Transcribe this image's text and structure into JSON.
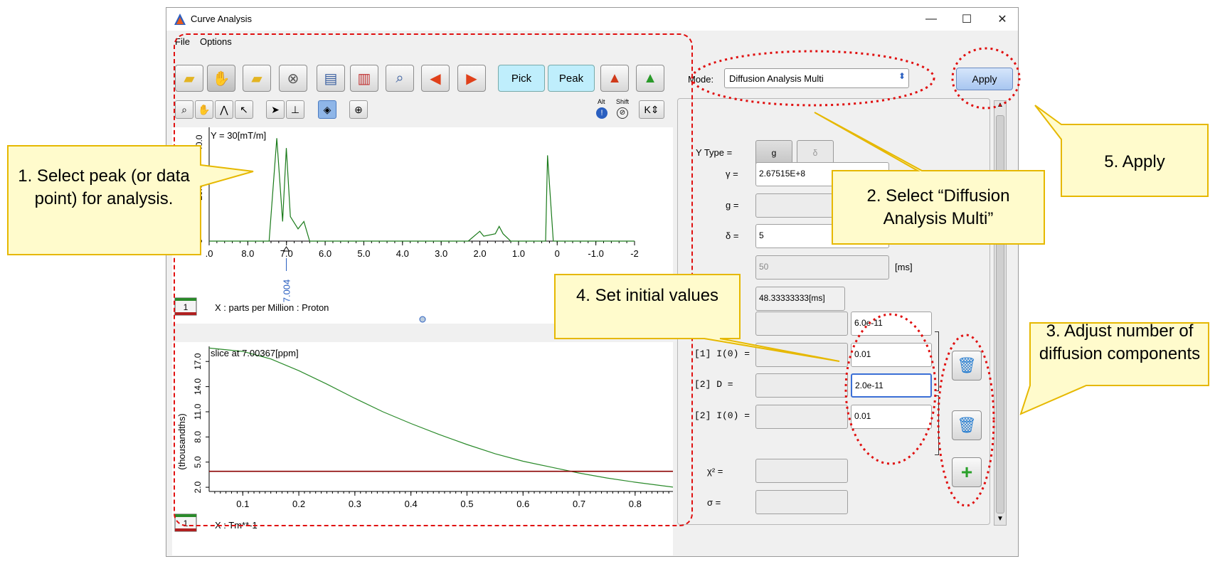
{
  "window": {
    "title": "Curve Analysis",
    "minimize": "—",
    "maximize": "☐",
    "close": "✕"
  },
  "menu": [
    "File",
    "Options"
  ],
  "toolbar": {
    "pick": "Pick",
    "peak": "Peak"
  },
  "mode": {
    "label": "Mode:",
    "value": "Diffusion Analysis Multi",
    "apply": "Apply"
  },
  "subtoolbar": {
    "alt": "Alt",
    "shift": "Shift"
  },
  "upper_plot": {
    "legend": "Y = 30[mT/m]",
    "peak_marker": "7.004",
    "x_ticks": [
      ".0",
      "8.0",
      "7.0",
      "6.0",
      "5.0",
      "4.0",
      "3.0",
      "2.0",
      "1.0",
      "0",
      "-1.0",
      "-2"
    ],
    "y_ticks": [
      "40.0",
      "20.0",
      "0"
    ],
    "xlabel": "X : parts per Million : Proton",
    "page": "1"
  },
  "lower_plot": {
    "legend": "slice at 7.00367[ppm]",
    "x_ticks": [
      "0.1",
      "0.2",
      "0.3",
      "0.4",
      "0.5",
      "0.6",
      "0.7",
      "0.8"
    ],
    "y_ticks": [
      "17.0",
      "14.0",
      "11.0",
      "8.0",
      "5.0",
      "2.0"
    ],
    "ylabel": "(thousandths)",
    "xlabel": "X : Tm**-1",
    "page": "1"
  },
  "chart_data": [
    {
      "type": "line",
      "title": "Y = 30[mT/m]",
      "xlabel": "X : parts per Million : Proton",
      "xlim": [
        9,
        -2
      ],
      "series": [
        {
          "x": [
            9,
            7.45,
            7.25,
            7.1,
            7.004,
            6.9,
            6.7,
            6.55,
            6.4,
            2.3,
            2.0,
            1.9,
            1.6,
            1.5,
            1.4,
            1.2,
            0.3,
            0.25,
            0.1,
            -2
          ],
          "y": [
            0,
            0,
            42,
            8,
            38,
            10,
            5,
            8,
            0,
            0,
            4,
            2,
            3,
            6,
            3,
            0,
            0,
            35,
            0,
            0
          ]
        }
      ],
      "color": "#1a7a1a"
    },
    {
      "type": "line",
      "title": "slice at 7.00367[ppm]",
      "xlabel": "X : Tm**-1",
      "ylabel": "(thousandths)",
      "xlim": [
        0.04,
        0.87
      ],
      "ylim": [
        1.5,
        18.8
      ],
      "series": [
        {
          "x": [
            0.04,
            0.1,
            0.15,
            0.2,
            0.25,
            0.3,
            0.35,
            0.4,
            0.45,
            0.5,
            0.55,
            0.6,
            0.65,
            0.7,
            0.75,
            0.8,
            0.87
          ],
          "y": [
            18.6,
            18.2,
            17.3,
            15.9,
            14.3,
            12.6,
            11.0,
            9.6,
            8.3,
            7.1,
            6.0,
            5.1,
            4.4,
            3.7,
            3.1,
            2.6,
            2.0
          ]
        },
        {
          "x": [
            0.04,
            0.87
          ],
          "y": [
            3.9,
            3.9
          ]
        }
      ],
      "colors": [
        "#2a8a2a",
        "#8b0000"
      ]
    }
  ],
  "params": {
    "ytype_label": "Y Type =",
    "ytype_buttons": [
      "g",
      "δ"
    ],
    "gamma_label": "γ =",
    "gamma_value": "2.67515E+8",
    "g_label": "g =",
    "delta_label": "δ =",
    "delta_value": "5",
    "delta_unit": "[ms]",
    "Delta_value": "50",
    "Delta_unit": "[ms]",
    "diff_time": "48.33333333[ms]",
    "rows": [
      {
        "label": "[1] D =",
        "value": "6.0e-11"
      },
      {
        "label": "[1] I(0) =",
        "value": "0.01"
      },
      {
        "label": "[2] D =",
        "value": "2.0e-11"
      },
      {
        "label": "[2] I(0) =",
        "value": "0.01"
      }
    ],
    "chi_label": "χ² =",
    "sigma_label": "σ ="
  },
  "callouts": {
    "c1": "1. Select peak (or data point) for analysis.",
    "c2": "2. Select “Diffusion Analysis Multi”",
    "c3": "3. Adjust number of diffusion components",
    "c4": "4. Set initial values",
    "c5": "5. Apply"
  }
}
